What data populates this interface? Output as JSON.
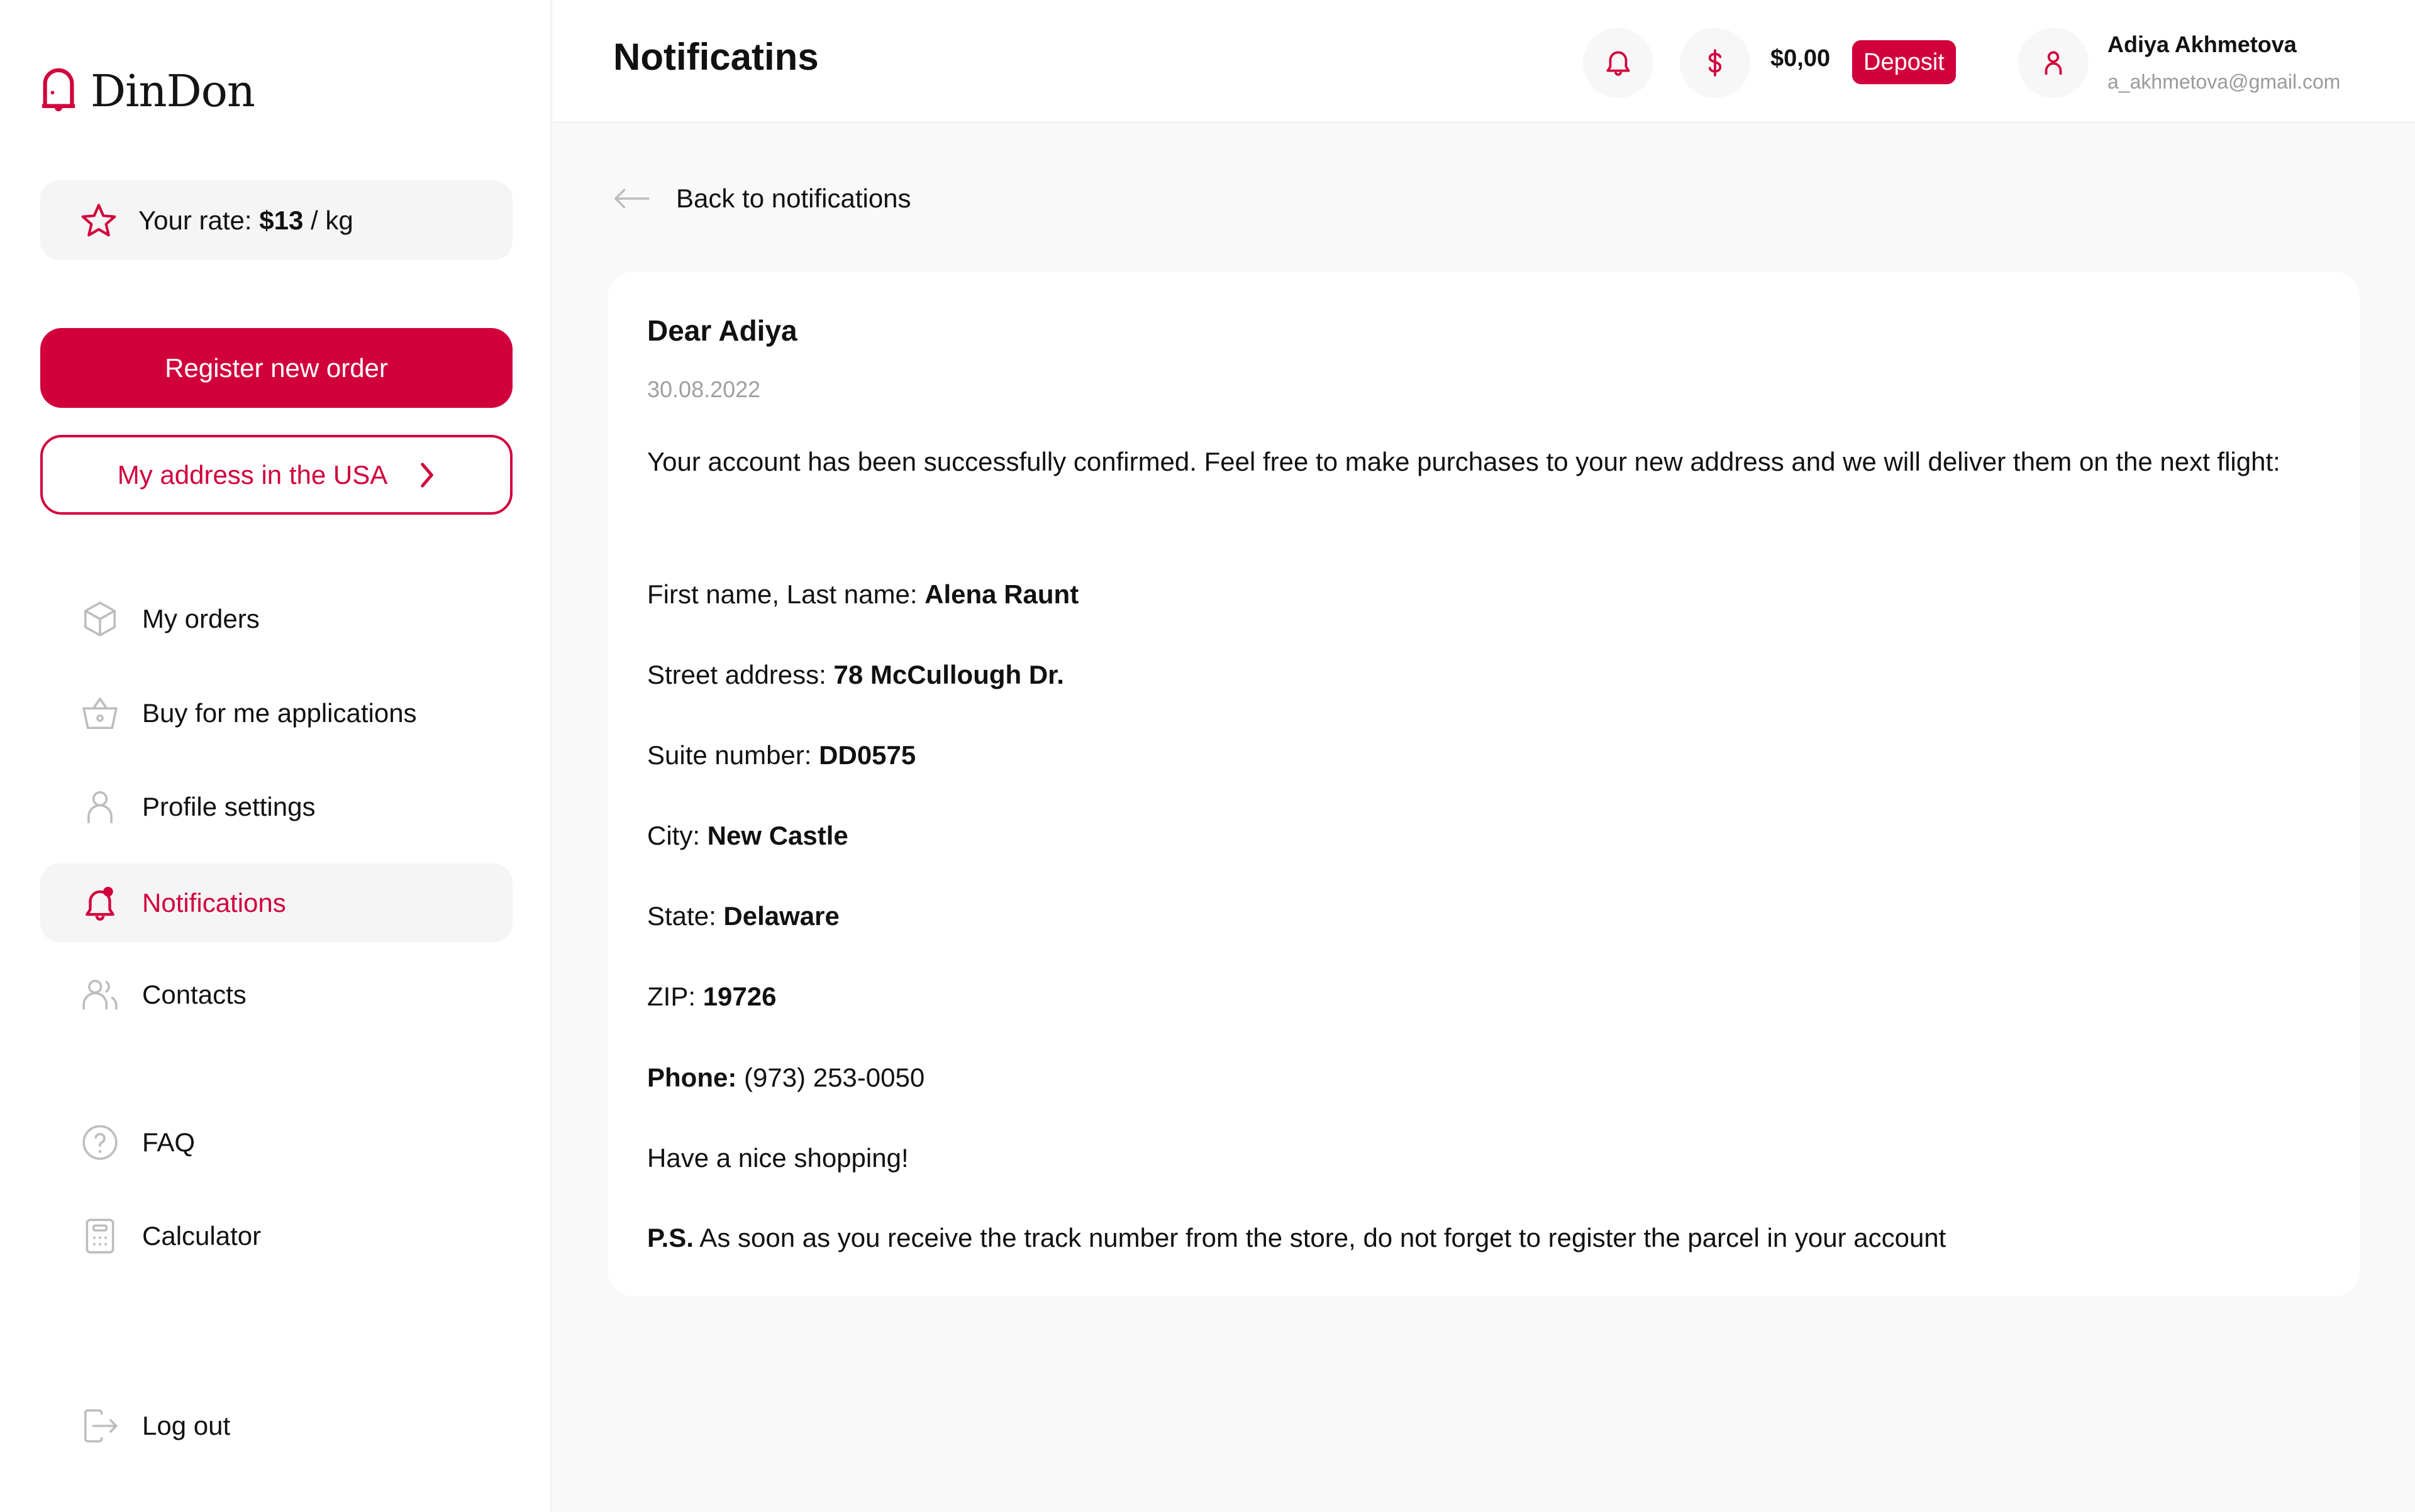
{
  "brand": {
    "name": "DinDon",
    "accent_color": "#d1003c"
  },
  "sidebar": {
    "rate": {
      "prefix": "Your rate: ",
      "value": "$13",
      "unit": " / kg"
    },
    "register_button": "Register new order",
    "address_button": "My address in the USA",
    "items": [
      {
        "label": "My orders",
        "icon": "box-icon"
      },
      {
        "label": "Buy for me applications",
        "icon": "basket-icon"
      },
      {
        "label": "Profile settings",
        "icon": "user-icon"
      },
      {
        "label": "Notifications",
        "icon": "bell-icon",
        "active": true
      },
      {
        "label": "Contacts",
        "icon": "users-icon"
      },
      {
        "label": "FAQ",
        "icon": "question-icon"
      },
      {
        "label": "Calculator",
        "icon": "calculator-icon"
      },
      {
        "label": "Log out",
        "icon": "logout-icon"
      }
    ]
  },
  "header": {
    "title": "Notificatins",
    "balance": "$0,00",
    "deposit_button": "Deposit",
    "user": {
      "name": "Adiya Akhmetova",
      "email": "a_akhmetova@gmail.com"
    }
  },
  "main": {
    "back_link": "Back to notifications",
    "notification": {
      "greeting": "Dear Adiya",
      "date": "30.08.2022",
      "intro": "Your account has been successfully confirmed. Feel free to make purchases to your new address and we will deliver them on the next flight:",
      "fields": [
        {
          "label": "First name, Last name: ",
          "value": "Alena Raunt"
        },
        {
          "label": "Street address: ",
          "value": "78 McCullough Dr."
        },
        {
          "label": "Suite number: ",
          "value": "DD0575"
        },
        {
          "label": "City: ",
          "value": "New Castle"
        },
        {
          "label": "State: ",
          "value": "Delaware"
        },
        {
          "label": "ZIP: ",
          "value": "19726"
        }
      ],
      "phone": {
        "label": "Phone: ",
        "value": "(973) 253-0050"
      },
      "closing": "Have a nice shopping!",
      "ps": {
        "label": "P.S.",
        "text": " As soon as you receive the track number from the store, do not forget to register the parcel in your account"
      }
    }
  }
}
